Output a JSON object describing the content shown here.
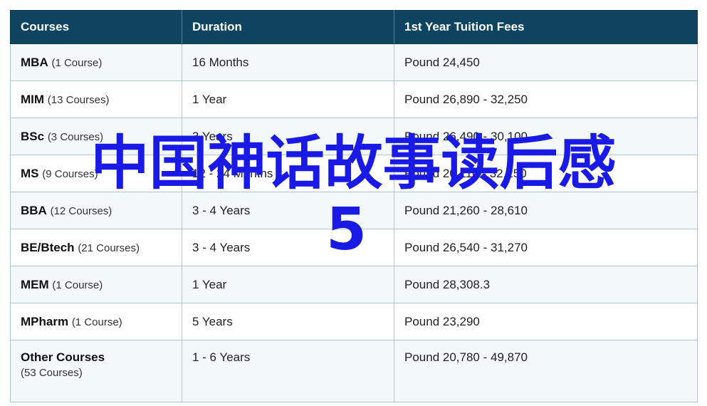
{
  "table": {
    "headers": [
      "Courses",
      "Duration",
      "1st Year Tuition Fees"
    ],
    "rows": [
      {
        "name": "MBA",
        "count": "(1 Course)",
        "duration": "16 Months",
        "fees": "Pound 24,450"
      },
      {
        "name": "MIM",
        "count": "(13 Courses)",
        "duration": "1 Year",
        "fees": "Pound 26,890 - 32,250"
      },
      {
        "name": "BSc",
        "count": "(3 Courses)",
        "duration": "3 Years",
        "fees": "Pound 26,490 - 30,100"
      },
      {
        "name": "MS",
        "count": "(9 Courses)",
        "duration": "12 - 24 Months",
        "fees": "Pound 20,110 - 32,250"
      },
      {
        "name": "BBA",
        "count": "(12 Courses)",
        "duration": "3 - 4 Years",
        "fees": "Pound 21,260 - 28,610"
      },
      {
        "name": "BE/Btech",
        "count": "(21 Courses)",
        "duration": "3 - 4 Years",
        "fees": "Pound 26,540 - 31,270"
      },
      {
        "name": "MEM",
        "count": "(1 Course)",
        "duration": "1 Year",
        "fees": "Pound 28,308.3"
      },
      {
        "name": "MPharm",
        "count": "(1 Course)",
        "duration": "5 Years",
        "fees": "Pound 23,290"
      },
      {
        "name": "Other Courses",
        "count": "(53 Courses)",
        "duration": "1 - 6 Years",
        "fees": "Pound 20,780 - 49,870"
      }
    ]
  },
  "overlay": {
    "line1": "中国神话故事读后感",
    "line2": "5",
    "color": "#1a1ae6"
  },
  "colors": {
    "header_bg": "#0e4460",
    "border": "#a9c7d6",
    "stripe": "#f3f8fb"
  }
}
